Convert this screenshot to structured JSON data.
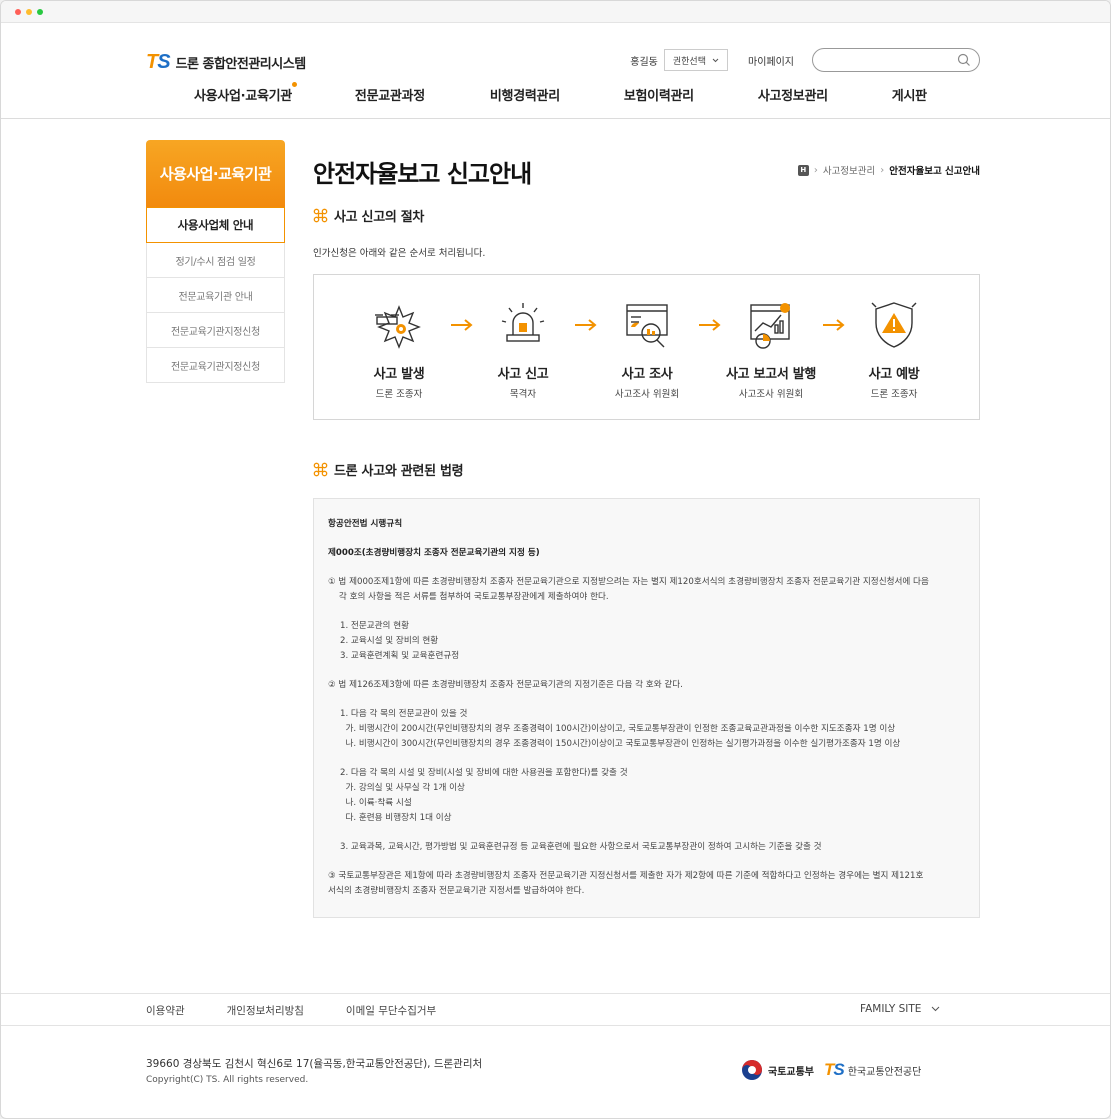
{
  "header": {
    "logo_mark": "TS",
    "logo_text": "드론 종합안전관리시스템",
    "user_name": "홍길동",
    "role_select": "권한선택",
    "mypage": "마이페이지",
    "search_placeholder": ""
  },
  "gnb": [
    "사용사업·교육기관",
    "전문교관과정",
    "비행경력관리",
    "보험이력관리",
    "사고정보관리",
    "게시판"
  ],
  "lnb": {
    "title": "사용사업·교육기관",
    "items": [
      "사용사업체 안내",
      "정기/수시 점검 일정",
      "전문교육기관 안내",
      "전문교육기관지정신청",
      "전문교육기관지정신청"
    ]
  },
  "page": {
    "title": "안전자율보고 신고안내",
    "breadcrumb": {
      "home_icon": "H",
      "level1": "사고정보관리",
      "current": "안전자율보고 신고안내"
    },
    "section1_title": "사고 신고의 절차",
    "section1_desc": "인가신청은 아래와 같은 순서로 처리됩니다.",
    "steps": [
      {
        "name": "사고 발생",
        "who": "드론 조종자",
        "icon": "drone-crash-icon"
      },
      {
        "name": "사고 신고",
        "who": "목격자",
        "icon": "siren-icon"
      },
      {
        "name": "사고 조사",
        "who": "사고조사 위원회",
        "icon": "investigation-icon"
      },
      {
        "name": "사고 보고서 발행",
        "who": "사고조사 위원회",
        "icon": "report-icon"
      },
      {
        "name": "사고 예방",
        "who": "드론 조종자",
        "icon": "shield-warning-icon"
      }
    ],
    "section2_title": "드론 사고와 관련된 법령",
    "law": {
      "heading": "항공안전법 시행규칙",
      "article": "제000조(초경량비행장치 조종자 전문교육기관의 지정 등)",
      "p1_1": "① 법 제000조제1항에 따른 초경량비행장치 조종자 전문교육기관으로 지정받으려는 자는 별지 제120호서식의 초경량비행장치 조종자 전문교육기관 지정신청서에 다음",
      "p1_2": "    각 호의 사항을 적은 서류를 첨부하여 국토교통부장관에게 제출하여야 한다.",
      "p1_items": [
        "1. 전문교관의 현황",
        "2. 교육시설 및 장비의 현황",
        "3. 교육훈련계획 및 교육훈련규정"
      ],
      "p2": "② 법 제126조제3항에 따른 초경량비행장치 조종자 전문교육기관의 지정기준은 다음 각 호와 같다.",
      "p2_1": "1. 다음 각 목의 전문교관이 있을 것",
      "p2_1_ga": "  가. 비행시간이 200시간(무인비행장치의 경우 조종경력이 100시간)이상이고, 국토교통부장관이 인정한 조종교육교관과정을 이수한 지도조종자 1명 이상",
      "p2_1_na": "  나. 비행시간이 300시간(무인비행장치의 경우 조종경력이 150시간)이상이고 국토교통부장관이 인정하는 실기평가과정을 이수한 실기평가조종자 1명 이상",
      "p2_2": "2. 다음 각 목의 시설 및 장비(시설 및 장비에 대한 사용권을 포함한다)를 갖출 것",
      "p2_2_items": [
        "  가. 강의실 및 사무실 각 1개 이상",
        "  나. 이륙·착륙 시설",
        "  다. 훈련용 비행장치 1대 이상"
      ],
      "p2_3": "3. 교육과목, 교육시간, 평가방법 및 교육훈련규정 등 교육훈련에 필요한 사항으로서 국토교통부장관이 정하여 고시하는 기준을 갖출 것",
      "p3_1": "③ 국토교통부장관은 제1항에 따라 초경량비행장치 조종자 전문교육기관 지정신청서를 제출한 자가 제2항에 따른 기준에 적합하다고 인정하는 경우에는 별지 제121호",
      "p3_2": "서식의 초경량비행장치 조종자 전문교육기관 지정서를 발급하여야 한다."
    }
  },
  "footer": {
    "links": [
      "이용약관",
      "개인정보처리방침",
      "이메일 무단수집거부"
    ],
    "family_site": "FAMILY SITE",
    "address": "39660 경상북도 김천시 혁신6로 17(율곡동,한국교통안전공단), 드론관리처",
    "copyright": "Copyright(C) TS. All rights reserved.",
    "molit": "국토교통부",
    "kotsa_mark": "TS",
    "kotsa": "한국교통안전공단"
  },
  "colors": {
    "accent": "#f39200",
    "blue": "#1e6fc6"
  }
}
